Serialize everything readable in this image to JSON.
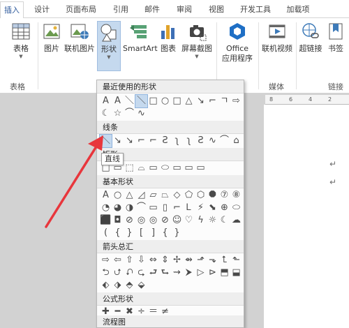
{
  "tabs": [
    "插入",
    "设计",
    "页面布局",
    "引用",
    "邮件",
    "审阅",
    "视图",
    "开发工具",
    "加载项"
  ],
  "ribbon": {
    "table": "表格",
    "picture": "图片",
    "online_picture": "联机图片",
    "shapes": "形状",
    "smartart": "SmartArt",
    "chart": "图表",
    "screenshot": "屏幕截图",
    "office_apps_line1": "Office",
    "office_apps_line2": "应用程序",
    "online_video": "联机视频",
    "hyperlink": "超链接",
    "bookmark": "书签",
    "group_table": "表格",
    "group_media": "媒体",
    "group_links": "链接"
  },
  "shapes_menu": {
    "recent": "最近使用的形状",
    "lines": "线条",
    "rect": "矩形",
    "basic": "基本形状",
    "arrows": "箭头总汇",
    "formula": "公式形状",
    "flowchart": "流程图",
    "recent_glyphs": [
      "A",
      "A",
      "＼",
      "＼",
      "□",
      "○",
      "□",
      "△",
      "↘",
      "⌐",
      "ㄱ",
      "⇨",
      "⇩"
    ],
    "recent_glyphs2": [
      "☾",
      "☆",
      "⌒",
      "∿"
    ],
    "line_glyphs": [
      "＼",
      "↘",
      "↘",
      "⌐",
      "⌐",
      "Ƨ",
      "ʅ",
      "ʅ",
      "Ƨ",
      "∿",
      "⌒",
      "⌂",
      "ℓ"
    ],
    "rect_glyphs": [
      "□",
      "▭",
      "⬚",
      "⌓",
      "▭",
      "⬭",
      "▭",
      "▭",
      "▭"
    ],
    "basic_row1": [
      "A",
      "○",
      "△",
      "◿",
      "▱",
      "⏢",
      "◇",
      "⬠",
      "⬡",
      "⯃",
      "⑦",
      "⑧"
    ],
    "basic_row2": [
      "◔",
      "◕",
      "◑",
      "⌒",
      "▭",
      "▯",
      "⌐",
      "Ꮮ",
      "⚡",
      "⬊",
      "⊕",
      "⬭"
    ],
    "basic_row3": [
      "⬛",
      "◘",
      "⊘",
      "◎",
      "◎",
      "⊘",
      "☺",
      "♡",
      "ϟ",
      "☼",
      "☾",
      "☁"
    ],
    "basic_row4": [
      "(",
      "{",
      "}",
      "[",
      "]",
      "{",
      "}"
    ],
    "arrow_row1": [
      "⇨",
      "⇦",
      "⇧",
      "⇩",
      "⇔",
      "⇕",
      "✢",
      "⇴",
      "⬏",
      "⬎",
      "⮤",
      "⬑"
    ],
    "arrow_row2": [
      "⮌",
      "⮍",
      "⮏",
      "⮎",
      "⮐",
      "⮑",
      "⇝",
      "⮞",
      "▷",
      "⊳",
      "⬒",
      "⬓"
    ],
    "arrow_row3": [
      "⬖",
      "⬗",
      "⬘",
      "⬙"
    ],
    "formula_row": [
      "✚",
      "━",
      "✖",
      "÷",
      "＝",
      "≠"
    ],
    "flow_row": [
      "□",
      "▭",
      "◇",
      "▱",
      "▭",
      "▭",
      "⬭",
      "▭",
      "⬭",
      "⬯",
      "⬡",
      "○"
    ]
  },
  "tooltip": "直线",
  "ruler": [
    "8",
    "6",
    "4",
    "2"
  ],
  "colors": {
    "accent": "#2b579a",
    "highlight": "#c5d9ee",
    "arrow": "#e8363c"
  }
}
